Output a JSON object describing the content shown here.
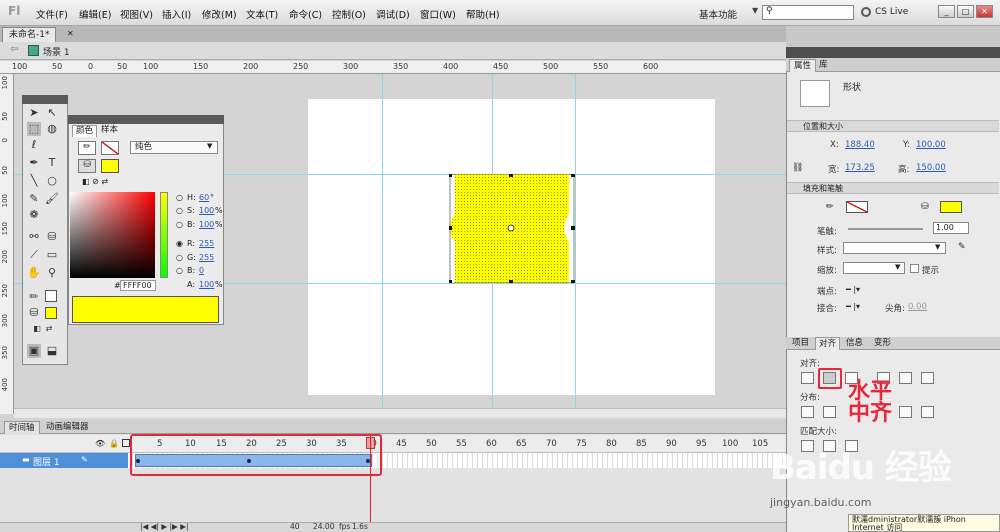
{
  "menubar": {
    "items": [
      "文件(F)",
      "编辑(E)",
      "视图(V)",
      "插入(I)",
      "修改(M)",
      "文本(T)",
      "命令(C)",
      "控制(O)",
      "调试(D)",
      "窗口(W)",
      "帮助(H)"
    ],
    "workspace": "基本功能",
    "search_placeholder": "",
    "cs_live": "CS Live"
  },
  "document": {
    "tab_label": "未命名-1*",
    "scene_label": "场景 1"
  },
  "rulers": {
    "top": [
      "100",
      "50",
      "0",
      "50",
      "100",
      "150",
      "200",
      "250",
      "300",
      "350",
      "400",
      "450",
      "500",
      "550",
      "600"
    ],
    "left": [
      "100",
      "50",
      "0",
      "50",
      "100",
      "150",
      "200",
      "250",
      "300",
      "350",
      "400"
    ]
  },
  "color_panel": {
    "tabs": [
      "颜色",
      "样本"
    ],
    "type": "纯色",
    "h_label": "H:",
    "h_value": "60",
    "h_unit": "°",
    "s_label": "S:",
    "s_value": "100",
    "s_unit": "%",
    "b_label": "B:",
    "b_value": "100",
    "b_unit": "%",
    "r_label": "R:",
    "r_value": "255",
    "g_label": "G:",
    "g_value": "255",
    "bb_label": "B:",
    "bb_value": "0",
    "a_label": "A:",
    "a_value": "100",
    "a_unit": "%",
    "hex_prefix": "#",
    "hex": "FFFF00",
    "fill_color": "#ffff00"
  },
  "properties": {
    "tabs": [
      "属性",
      "库"
    ],
    "object_type": "形状",
    "section_position": "位置和大小",
    "x_label": "X:",
    "x_value": "188.40",
    "y_label": "Y:",
    "y_value": "100.00",
    "w_label": "宽:",
    "w_value": "173.25",
    "h_label": "高:",
    "h_value": "150.00",
    "section_fill": "填充和笔触",
    "stroke_label": "笔触:",
    "stroke_value": "1.00",
    "style_label": "样式:",
    "scale_label": "缩放:",
    "hint_label": "提示",
    "cap_label": "端点:",
    "join_label": "接合:",
    "miter_label": "尖角:",
    "miter_value": "0.00"
  },
  "align_panel": {
    "tabs": [
      "项目",
      "对齐",
      "信息",
      "变形"
    ],
    "align_label": "对齐:",
    "distribute_label": "分布:",
    "match_label": "匹配大小:",
    "annotation_line1": "水平",
    "annotation_line2": "中齐"
  },
  "timeline": {
    "tabs": [
      "时间轴",
      "动画编辑器"
    ],
    "frame_numbers": [
      "5",
      "10",
      "15",
      "20",
      "25",
      "30",
      "35",
      "40",
      "45",
      "50",
      "55",
      "60",
      "65",
      "70",
      "75",
      "80",
      "85",
      "90",
      "95",
      "100",
      "105"
    ],
    "layer_name": "图层 1",
    "current_frame": "40",
    "fps": "24.00",
    "fps_unit": "fps",
    "time": "1.6",
    "time_unit": "s"
  },
  "watermark": {
    "text": "Baidu 经验",
    "url": "jingyan.baidu.com"
  },
  "tooltip": {
    "line1": "默濡dministrator默濡簇 iPhon",
    "line2": "Internet 访问"
  }
}
